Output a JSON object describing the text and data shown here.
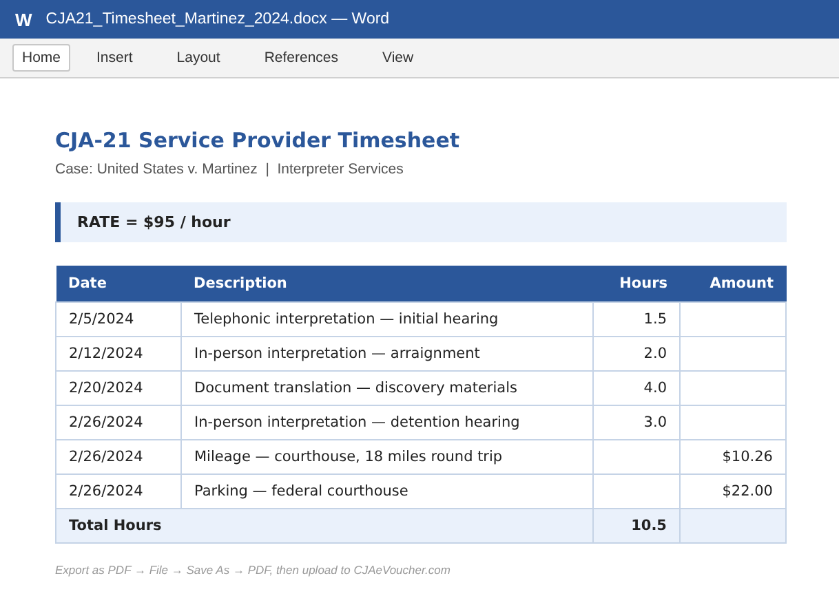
{
  "window": {
    "app_icon": "W",
    "title": "CJA21_Timesheet_Martinez_2024.docx — Word"
  },
  "tabs": [
    {
      "label": "Home",
      "selected": true
    },
    {
      "label": "Insert",
      "selected": false
    },
    {
      "label": "Layout",
      "selected": false
    },
    {
      "label": "References",
      "selected": false
    },
    {
      "label": "View",
      "selected": false
    }
  ],
  "document": {
    "heading": "CJA-21 Service Provider Timesheet",
    "subtitle": "Case: United States v. Martinez  |  Interpreter Services",
    "rate": "RATE = $95 / hour",
    "table": {
      "columns": [
        "Date",
        "Description",
        "Hours",
        "Amount"
      ],
      "rows": [
        {
          "date": "2/5/2024",
          "description": "Telephonic interpretation — initial hearing",
          "hours": "1.5",
          "amount": ""
        },
        {
          "date": "2/12/2024",
          "description": "In-person interpretation — arraignment",
          "hours": "2.0",
          "amount": ""
        },
        {
          "date": "2/20/2024",
          "description": "Document translation — discovery materials",
          "hours": "4.0",
          "amount": ""
        },
        {
          "date": "2/26/2024",
          "description": "In-person interpretation — detention hearing",
          "hours": "3.0",
          "amount": ""
        },
        {
          "date": "2/26/2024",
          "description": "Mileage — courthouse, 18 miles round trip",
          "hours": "",
          "amount": "$10.26"
        },
        {
          "date": "2/26/2024",
          "description": "Parking — federal courthouse",
          "hours": "",
          "amount": "$22.00"
        }
      ],
      "total": {
        "label": "Total Hours",
        "hours": "10.5"
      }
    },
    "footnote": "Export as PDF → File → Save As → PDF, then upload to CJAeVoucher.com"
  }
}
